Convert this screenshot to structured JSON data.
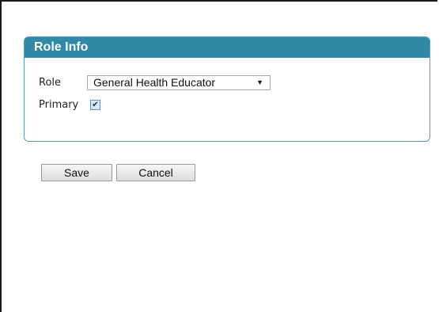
{
  "panel": {
    "title": "Role Info"
  },
  "form": {
    "role_label": "Role",
    "role_selected": "General Health Educator",
    "primary_label": "Primary",
    "primary_checked": true
  },
  "actions": {
    "save_label": "Save",
    "cancel_label": "Cancel"
  },
  "colors": {
    "header_bg": "#2f8aa8",
    "panel_border": "#5a9bb5"
  },
  "icons": {
    "dropdown": "chevron-down-icon",
    "checkbox": "check-icon"
  }
}
